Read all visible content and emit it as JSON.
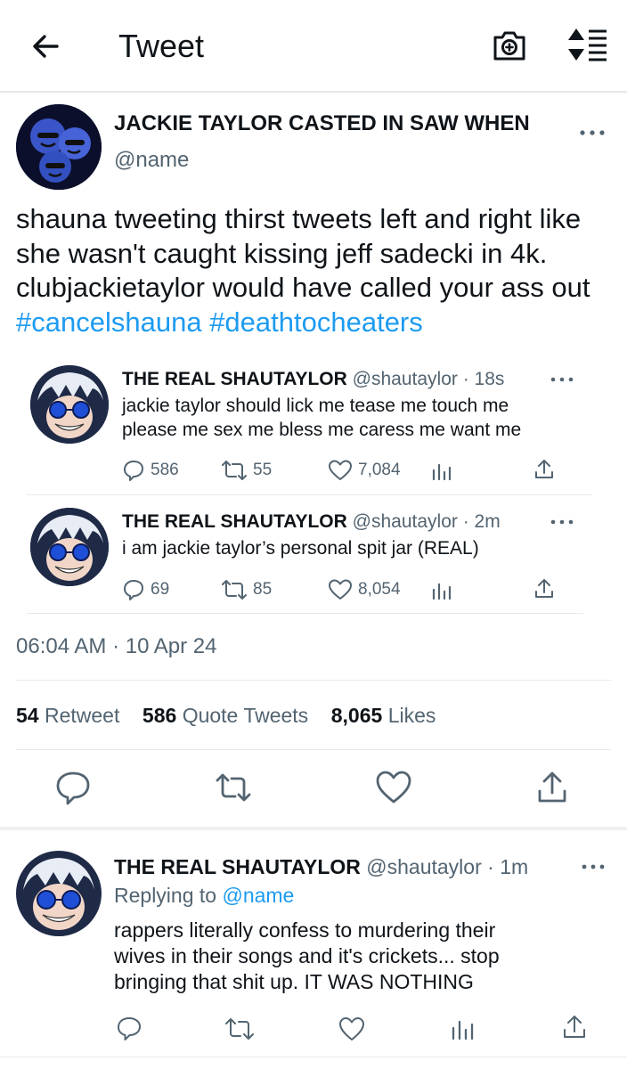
{
  "header": {
    "title": "Tweet",
    "back_icon": "arrow-left-icon",
    "camera_icon": "camera-plus-icon",
    "sort_icon": "sort-lines-icon"
  },
  "main_tweet": {
    "display_name": "JACKIE TAYLOR CASTED IN SAW WHEN",
    "handle": "@name",
    "text_plain": "shauna tweeting thirst tweets left and right like she wasn't caught kissing jeff sadecki in 4k. clubjackietaylor would have called your ass out ",
    "hashtags": [
      "#cancelshauna",
      "#deathtocheaters"
    ],
    "timestamp": "06:04 AM · 10 Apr 24",
    "counts": {
      "retweets": "54",
      "retweets_label": "Retweet",
      "quotes": "586",
      "quotes_label": "Quote Tweets",
      "likes": "8,065",
      "likes_label": "Likes"
    }
  },
  "quotes": [
    {
      "display_name": "THE REAL SHAUTAYLOR",
      "handle": "@shautaylor",
      "time": "· 18s",
      "line1": "jackie taylor should lick me tease me touch me",
      "line2": "please me sex me bless me caress me want me",
      "replies": "586",
      "retweets": "55",
      "likes": "7,084"
    },
    {
      "display_name": "THE REAL SHAUTAYLOR",
      "handle": "@shautaylor",
      "time": "· 2m",
      "line1": "i am jackie taylor’s personal spit jar (REAL)",
      "replies": "69",
      "retweets": "85",
      "likes": "8,054"
    }
  ],
  "reply": {
    "display_name": "THE REAL SHAUTAYLOR",
    "handle": "@shautaylor",
    "time": "· 1m",
    "replying_label": "Replying to",
    "replying_handle": "@name",
    "line1": "rappers literally confess to murdering their",
    "line2": "wives in their songs and it's crickets... stop",
    "line3": "bringing that shit up. IT WAS NOTHING"
  },
  "colors": {
    "accent": "#1d9bf0",
    "text": "#0f1419",
    "muted": "#536471",
    "divider": "#e6e9ec"
  }
}
